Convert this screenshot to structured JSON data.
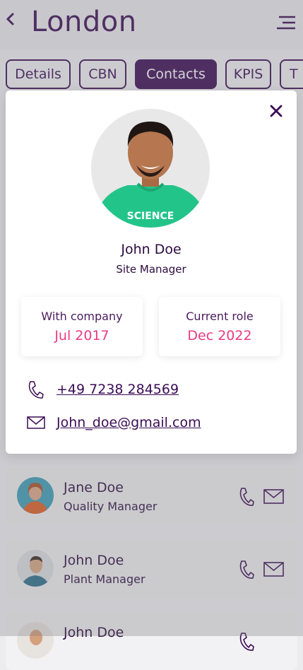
{
  "header": {
    "title": "London"
  },
  "tabs": [
    {
      "label": "Details",
      "active": false
    },
    {
      "label": "CBN",
      "active": false
    },
    {
      "label": "Contacts",
      "active": true
    },
    {
      "label": "KPIS",
      "active": false
    },
    {
      "label": "T",
      "active": false
    }
  ],
  "contacts": [
    {
      "name": "Jane Doe",
      "role": "Quality Manager"
    },
    {
      "name": "John Doe",
      "role": "Plant Manager"
    },
    {
      "name": "John Doe",
      "role": ""
    }
  ],
  "modal": {
    "name": "John Doe",
    "role": "Site Manager",
    "with_company_label": "With company",
    "with_company_value": "Jul 2017",
    "current_role_label": "Current role",
    "current_role_value": "Dec 2022",
    "phone": "+49 7238 284569",
    "email": "John_doe@gmail.com",
    "photo_shirt_text": "SCIENCE"
  },
  "colors": {
    "brand": "#3b0c55",
    "accent": "#ea3a84"
  }
}
